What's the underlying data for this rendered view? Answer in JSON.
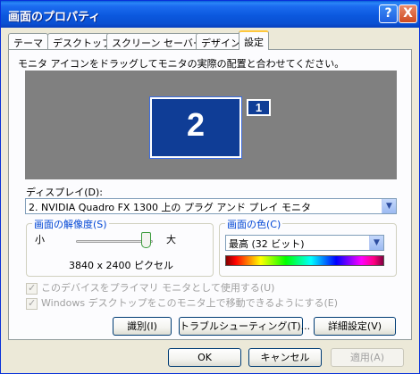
{
  "window": {
    "title": "画面のプロパティ",
    "help_glyph": "?",
    "close_glyph": "X"
  },
  "tabs": [
    {
      "label": "テーマ"
    },
    {
      "label": "デスクトップ"
    },
    {
      "label": "スクリーン セーバー"
    },
    {
      "label": "デザイン"
    },
    {
      "label": "設定"
    }
  ],
  "settings": {
    "instruction": "モニタ アイコンをドラッグしてモニタの実際の配置と合わせてください。",
    "monitors": {
      "primary_label": "2",
      "secondary_label": "1"
    },
    "display_label": "ディスプレイ(D):",
    "display_value": "2. NVIDIA Quadro FX 1300 上の プラグ アンド プレイ モニタ",
    "resolution": {
      "group_title": "画面の解像度(S)",
      "small_label": "小",
      "large_label": "大",
      "value_text": "3840 x 2400 ピクセル",
      "slider_position": 1.0
    },
    "color": {
      "group_title": "画面の色(C)",
      "value": "最高 (32 ビット)"
    },
    "checkbox_primary": "このデバイスをプライマリ モニタとして使用する(U)",
    "checkbox_extend": "Windows デスクトップをこのモニタ上で移動できるようにする(E)",
    "identify_button": "識別(I)",
    "troubleshoot_button": "トラブルシューティング(T)...",
    "advanced_button": "詳細設定(V)"
  },
  "footer": {
    "ok": "OK",
    "cancel": "キャンセル",
    "apply": "適用(A)"
  },
  "colors": {
    "title_bar": "#0b58de",
    "monitor_blue": "#0f3d96",
    "monitor_area": "#808080",
    "active_tab_accent": "#ffc83c"
  },
  "icons": {
    "help": "help-icon",
    "close": "close-icon",
    "dropdown": "chevron-down-icon"
  }
}
